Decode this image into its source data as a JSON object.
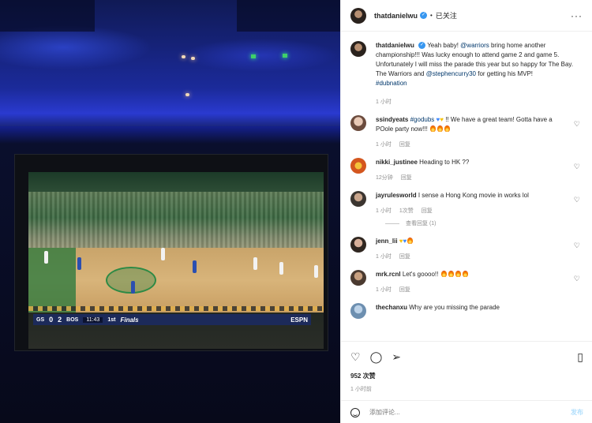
{
  "header": {
    "username": "thatdanielwu",
    "follow_status": "已关注",
    "more": "···"
  },
  "caption": {
    "username": "thatdanielwu",
    "text_1": "Yeah baby! ",
    "mention_1": "@warriors",
    "text_2": " bring home another championship!!! Was lucky enough to attend game 2 and game 5. Unfortunately I will miss the parade this year but so happy for The Bay. The Warriors and ",
    "mention_2": "@stephencurry30",
    "text_3": " for getting his MVP!",
    "hashtag": "#dubnation",
    "time": "1 小时"
  },
  "comments": [
    {
      "username": "ssindyeats",
      "hashtag": "#godubs",
      "text": " !! We have a great team! Gotta have a POole party now!!!",
      "time": "1 小时",
      "reply": "回复"
    },
    {
      "username": "nikki_justinee",
      "text": "Heading to HK ??",
      "time": "12分钟",
      "reply": "回复"
    },
    {
      "username": "jayrulesworld",
      "text": "I sense a Hong Kong movie in works lol",
      "time": "1 小时",
      "likes": "1次赞",
      "reply": "回复",
      "view_replies": "查看回复 (1)"
    },
    {
      "username": "jenn_lii",
      "text": "",
      "time": "1 小时",
      "reply": "回复"
    },
    {
      "username": "mrk.rcnl",
      "text": "Let's goooo!!",
      "time": "1 小时",
      "reply": "回复"
    },
    {
      "username": "thechanxu",
      "text": "Why are you missing the parade",
      "time": "",
      "reply": ""
    }
  ],
  "actions": {
    "likes": "952 次赞",
    "time_ago": "1 小时前",
    "comment_placeholder": "添加评论...",
    "post_label": "发布"
  },
  "scoreboard": {
    "away": "GS",
    "away_score": "0",
    "home_score": "2",
    "home": "BOS",
    "clock": "11:43",
    "quarter": "1st",
    "finals": "Finals",
    "network": "ESPN"
  },
  "colors": {
    "link": "#00376b",
    "verified": "#3897f0",
    "post_disabled": "#b2dffc",
    "meta": "#8e8e8e"
  }
}
